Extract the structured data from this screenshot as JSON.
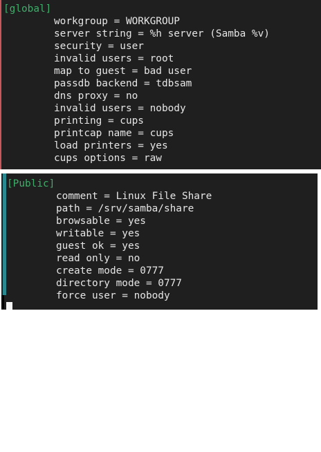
{
  "colors": {
    "background": "#1f1f1f",
    "text": "#e6e6e6",
    "section_header": "#3fae6a",
    "global_gutter": "#c9565b",
    "public_gutter": "#2a8a92"
  },
  "global_section": {
    "header": "[global]",
    "lines": [
      "workgroup = WORKGROUP",
      "server string = %h server (Samba %v)",
      "security = user",
      "invalid users = root",
      "map to guest = bad user",
      "passdb backend = tdbsam",
      "dns proxy = no",
      "invalid users = nobody",
      "printing = cups",
      "printcap name = cups",
      "load printers = yes",
      "cups options = raw"
    ]
  },
  "public_section": {
    "header": "[Public]",
    "lines": [
      "comment = Linux File Share",
      "path = /srv/samba/share",
      "browsable = yes",
      "writable = yes",
      "guest ok = yes",
      "read only = no",
      "create mode = 0777",
      "directory mode = 0777",
      "force user = nobody"
    ]
  }
}
